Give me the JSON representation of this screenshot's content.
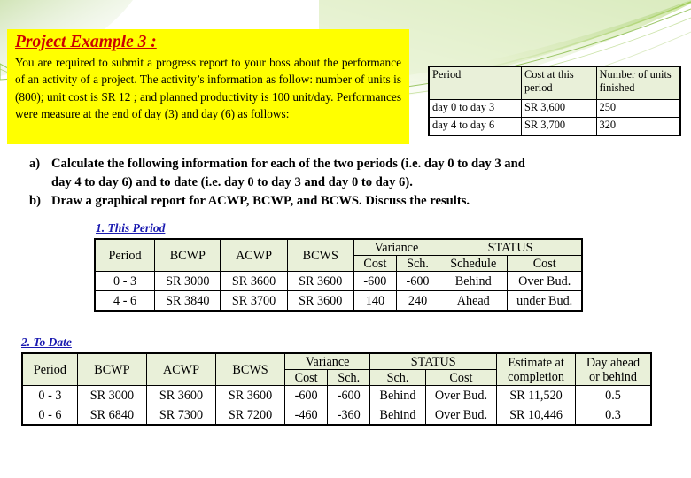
{
  "problem": {
    "title": "Project Example 3 :",
    "body": "You are required to submit a progress report to your boss about the performance of an activity of a project. The activity’s information as follow: number of units is (800); unit cost is SR 12 ; and planned productivity is 100 unit/day. Performances were measure at the end of day (3) and day (6) as follows:"
  },
  "period_table": {
    "headers": [
      "Period",
      "Cost at this period",
      "Number of units finished"
    ],
    "rows": [
      [
        "day 0 to day 3",
        "SR 3,600",
        "250"
      ],
      [
        "day 4 to day 6",
        "SR 3,700",
        "320"
      ]
    ]
  },
  "questions": [
    {
      "marker": "a)",
      "lines": [
        "Calculate the following information for each of the two periods (i.e. day 0 to day 3 and",
        "day 4 to day 6) and to date (i.e. day 0 to day 3 and day 0 to day 6)."
      ]
    },
    {
      "marker": "b)",
      "lines": [
        "Draw a graphical report for ACWP, BCWP, and BCWS. Discuss the results."
      ]
    }
  ],
  "this_period": {
    "heading": "1. This Period",
    "headers_top": [
      "Period",
      "BCWP",
      "ACWP",
      "BCWS",
      "Variance",
      "STATUS"
    ],
    "headers_sub": [
      "Cost",
      "Sch.",
      "Schedule",
      "Cost"
    ],
    "rows": [
      [
        "0 - 3",
        "SR 3000",
        "SR 3600",
        "SR 3600",
        "-600",
        "-600",
        "Behind",
        "Over Bud."
      ],
      [
        "4 - 6",
        "SR 3840",
        "SR 3700",
        "SR 3600",
        "140",
        "240",
        "Ahead",
        "under Bud."
      ]
    ]
  },
  "to_date": {
    "heading": "2. To Date",
    "headers_top": [
      "Period",
      "BCWP",
      "ACWP",
      "BCWS",
      "Variance",
      "STATUS",
      "Estimate at completion",
      "Day ahead or behind"
    ],
    "headers_sub": [
      "Cost",
      "Sch.",
      "Sch.",
      "Cost"
    ],
    "estimate_l1": "Estimate at",
    "estimate_l2": "completion",
    "dayahead_l1": "Day ahead",
    "dayahead_l2": "or behind",
    "rows": [
      [
        "0 - 3",
        "SR 3000",
        "SR 3600",
        "SR 3600",
        "-600",
        "-600",
        "Behind",
        "Over Bud.",
        "SR 11,520",
        "0.5"
      ],
      [
        "0 - 6",
        "SR 6840",
        "SR 7300",
        "SR 7200",
        "-460",
        "-360",
        "Behind",
        "Over Bud.",
        "SR 10,446",
        "0.3"
      ]
    ]
  },
  "colors": {
    "highlight": "#ffff00",
    "title_red": "#cc0000",
    "heading_blue": "#1a1ab0",
    "table_header_green": "#e9f0d9",
    "deco_green": "#8cc63f"
  }
}
